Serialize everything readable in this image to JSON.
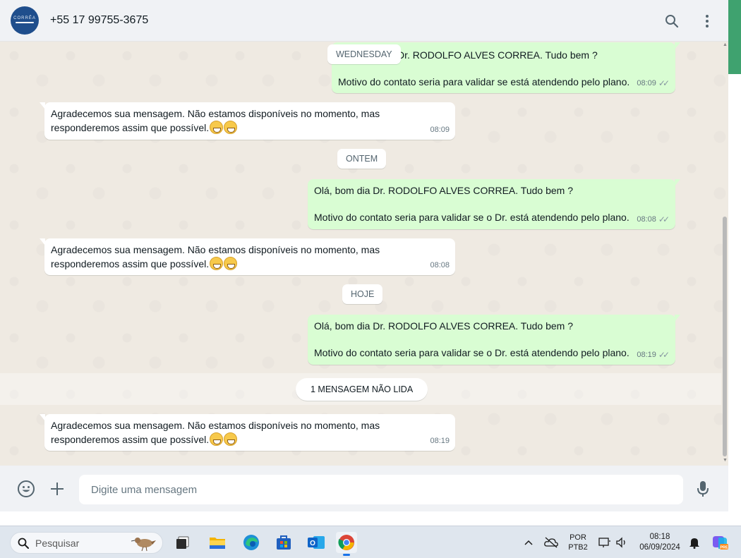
{
  "header": {
    "contact": "+55 17 99755-3675",
    "avatar_text": "CORRÊA"
  },
  "messages": [
    {
      "line1": "Dr. RODOLFO ALVES CORREA. Tudo bem ?",
      "line2": "Motivo do contato seria para validar se está atendendo pelo plano.",
      "time": "08:09"
    },
    {
      "line1": "Agradecemos sua mensagem. Não estamos disponíveis no momento, mas",
      "line2": "responderemos assim que possível.",
      "time": "08:09"
    },
    {
      "line1": "Olá, bom dia Dr. RODOLFO ALVES CORREA. Tudo bem ?",
      "line2": "Motivo do contato seria para validar se o Dr. está atendendo pelo plano.",
      "time": "08:08"
    },
    {
      "line1": "Agradecemos sua mensagem. Não estamos disponíveis no momento, mas",
      "line2": "responderemos assim que possível.",
      "time": "08:08"
    },
    {
      "line1": "Olá, bom dia Dr. RODOLFO ALVES CORREA. Tudo bem ?",
      "line2": "Motivo do contato seria para validar se o Dr. está atendendo pelo plano.",
      "time": "08:19"
    },
    {
      "line1": "Agradecemos sua mensagem. Não estamos disponíveis no momento, mas",
      "line2": "responderemos assim que possível.",
      "time": "08:19"
    }
  ],
  "dividers": {
    "wednesday": "WEDNESDAY",
    "ontem": "ONTEM",
    "hoje": "HOJE",
    "unread": "1 MENSAGEM NÃO LIDA"
  },
  "composer": {
    "placeholder": "Digite uma mensagem"
  },
  "taskbar": {
    "search_label": "Pesquisar",
    "lang_line1": "POR",
    "lang_line2": "PTB2",
    "time": "08:18",
    "date": "06/09/2024",
    "copilot_badge": "PRE"
  },
  "colors": {
    "outgoing_bubble": "#d9fdd3",
    "incoming_bubble": "#ffffff",
    "chat_background": "#efeae2",
    "accent_green": "#3fa26f",
    "avatar_blue": "#1f4e8c"
  }
}
